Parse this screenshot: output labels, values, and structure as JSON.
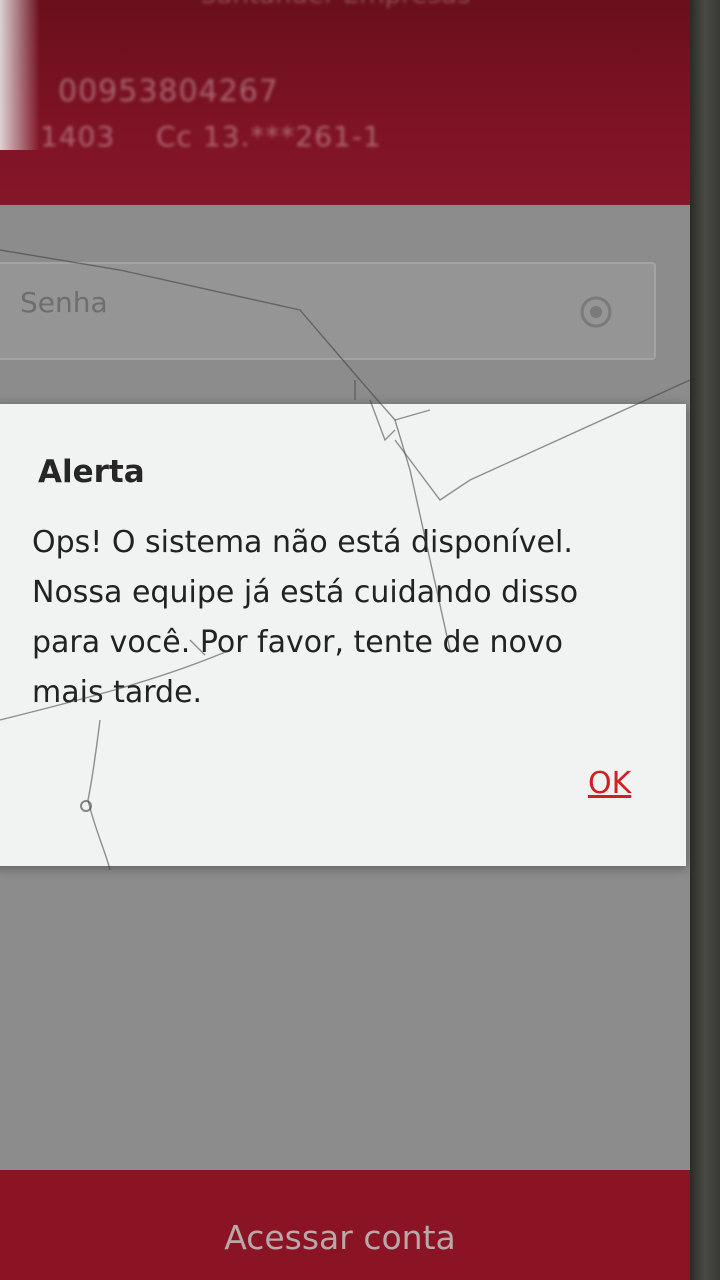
{
  "header": {
    "brand": "Santander Empresas",
    "account_id": "00953804267",
    "agency": "1403",
    "account": "Cc 13.***261-1"
  },
  "login": {
    "password_placeholder": "Senha",
    "toggle_icon": "eye-icon"
  },
  "dialog": {
    "title": "Alerta",
    "message": "Ops! O sistema não está disponível. Nossa equipe já está cuidando disso para você. Por favor, tente de novo mais tarde.",
    "ok_label": "OK"
  },
  "footer": {
    "access_label": "Acessar conta"
  },
  "colors": {
    "brand_red": "#8a1424",
    "ok_red": "#d31f1f",
    "dialog_bg": "#f1f2f2"
  }
}
